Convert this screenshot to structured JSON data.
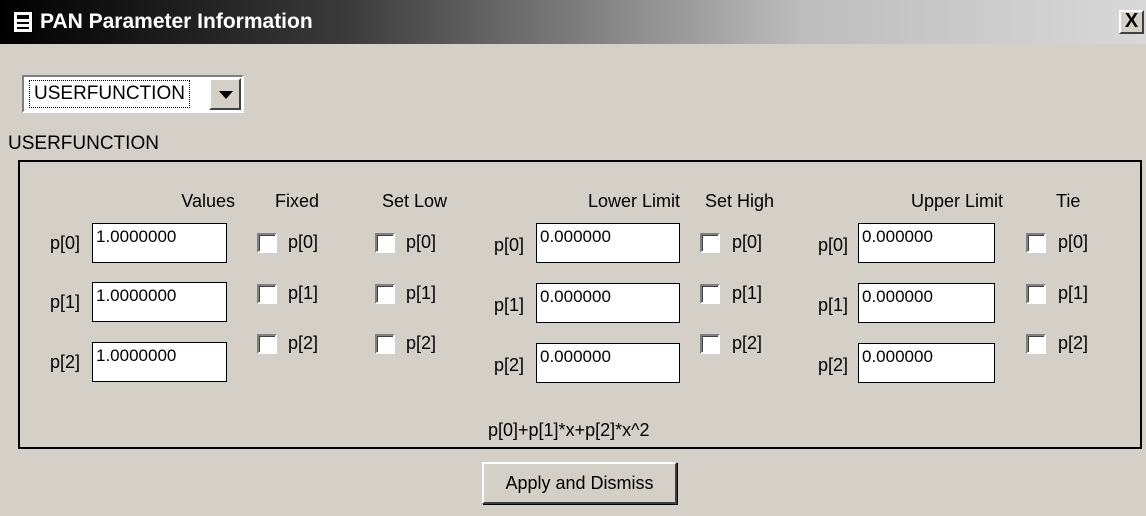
{
  "window": {
    "title": "PAN Parameter Information",
    "close_label": "X"
  },
  "function_select": {
    "value": "USERFUNCTION"
  },
  "function_name": "USERFUNCTION",
  "columns": {
    "values": "Values",
    "fixed": "Fixed",
    "set_low": "Set Low",
    "lower_limit": "Lower Limit",
    "set_high": "Set High",
    "upper_limit": "Upper Limit",
    "tie": "Tie"
  },
  "params": [
    {
      "name": "p[0]",
      "value": "1.0000000",
      "lower": "0.000000",
      "upper": "0.000000",
      "fixed": false,
      "set_low": false,
      "set_high": false,
      "tie": false
    },
    {
      "name": "p[1]",
      "value": "1.0000000",
      "lower": "0.000000",
      "upper": "0.000000",
      "fixed": false,
      "set_low": false,
      "set_high": false,
      "tie": false
    },
    {
      "name": "p[2]",
      "value": "1.0000000",
      "lower": "0.000000",
      "upper": "0.000000",
      "fixed": false,
      "set_low": false,
      "set_high": false,
      "tie": false
    }
  ],
  "formula": "p[0]+p[1]*x+p[2]*x^2",
  "apply_button": "Apply and Dismiss"
}
